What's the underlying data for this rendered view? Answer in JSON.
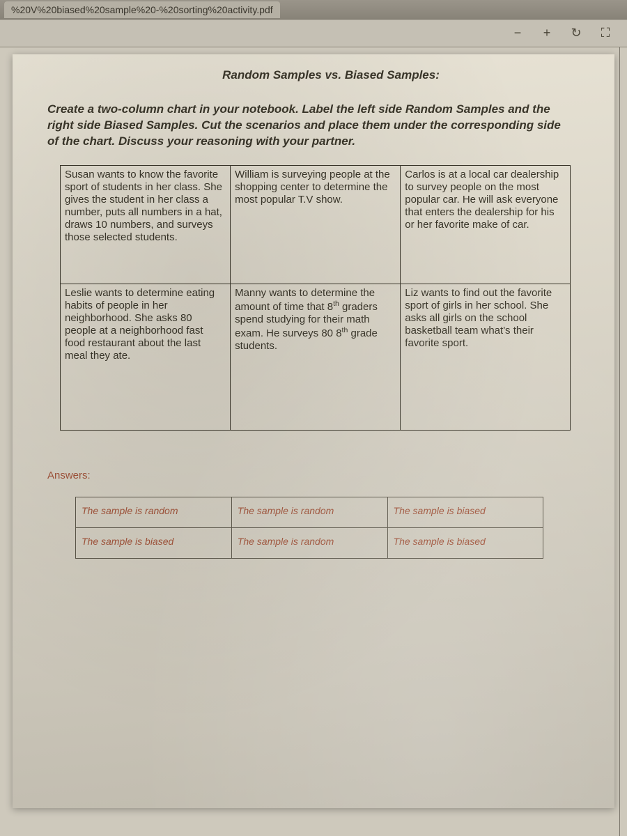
{
  "browser": {
    "tab_text": "%20V%20biased%20sample%20-%20sorting%20activity.pdf"
  },
  "toolbar": {
    "zoom_out": "−",
    "zoom_in": "+",
    "rotate": "↻",
    "fit": "⛶"
  },
  "doc": {
    "title": "Random Samples vs. Biased Samples:",
    "instructions": "Create a two-column chart in your notebook. Label the left side Random Samples and the right side Biased Samples. Cut the scenarios and place them under the corresponding side of the chart. Discuss your reasoning with your partner.",
    "scenarios": {
      "r1c1": "Susan wants to know the favorite sport of students in her class. She gives the student in her class a number, puts all numbers in a hat, draws 10 numbers, and surveys those selected students.",
      "r1c2": "William is surveying people at the shopping center to determine the most popular T.V show.",
      "r1c3": "Carlos is at a local car dealership to survey people on the most popular car. He will ask everyone that enters the dealership for his or her favorite make of car.",
      "r2c1": "Leslie wants to determine eating habits of people in her neighborhood. She asks 80 people at a neighborhood fast food restaurant about the last meal they ate.",
      "r2c2_pre": "Manny wants to determine the amount of time that 8",
      "r2c2_mid": " graders spend studying for their math exam. He surveys 80 8",
      "r2c2_post": " grade students.",
      "r2c3": "Liz wants to find out the favorite sport of girls in her school. She asks all girls on the school basketball team what's their favorite sport."
    },
    "answers_label": "Answers:",
    "answers": {
      "r1c1": "The sample is random",
      "r1c2": "The sample is random",
      "r1c3": "The sample is biased",
      "r2c1": "The sample is biased",
      "r2c2": "The sample is random",
      "r2c3": "The sample is biased"
    }
  }
}
